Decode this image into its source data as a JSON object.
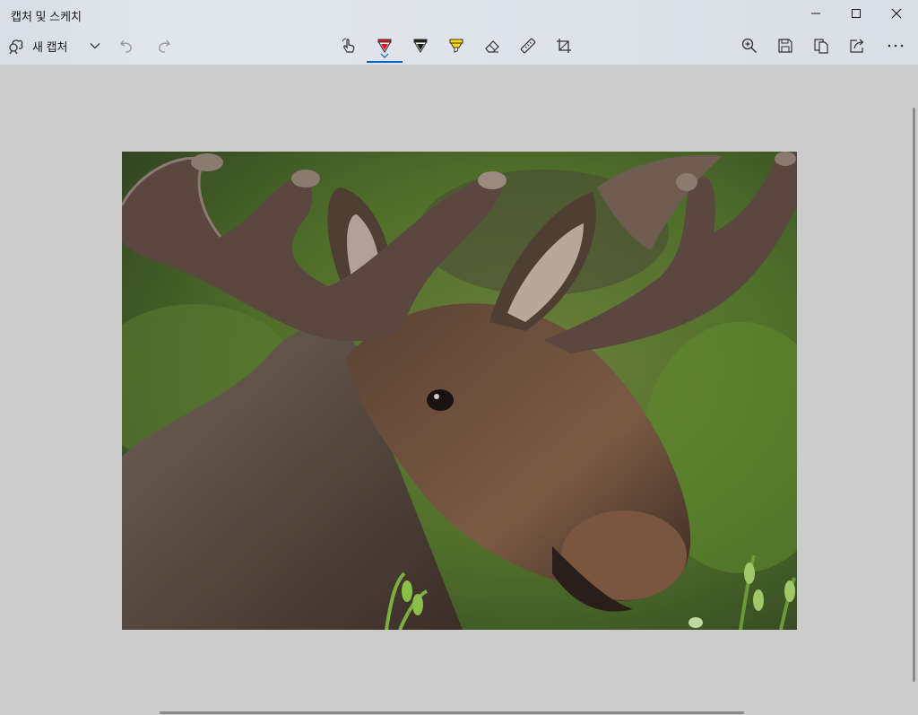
{
  "window": {
    "title": "캡처 및 스케치"
  },
  "toolbar": {
    "new_snip_label": "새 캡처",
    "icons": {
      "new_snip": "snip-icon",
      "dropdown": "chevron-down-icon",
      "undo": "undo-icon",
      "redo": "redo-icon",
      "touch": "touch-writing-icon",
      "ballpoint": "ballpoint-pen-icon",
      "pencil": "pencil-icon",
      "highlighter": "highlighter-icon",
      "eraser": "eraser-icon",
      "ruler": "ruler-icon",
      "crop": "crop-icon",
      "zoom": "zoom-in-icon",
      "save": "save-icon",
      "copy": "copy-icon",
      "share": "share-icon",
      "more": "more-icon"
    },
    "selected_tool": "ballpoint-pen",
    "colors": {
      "ballpoint": "#e81123",
      "pencil": "#1a1a1a",
      "highlighter": "#ffd800",
      "accent": "#0067c0"
    }
  },
  "canvas": {
    "image_subject": "moose"
  }
}
